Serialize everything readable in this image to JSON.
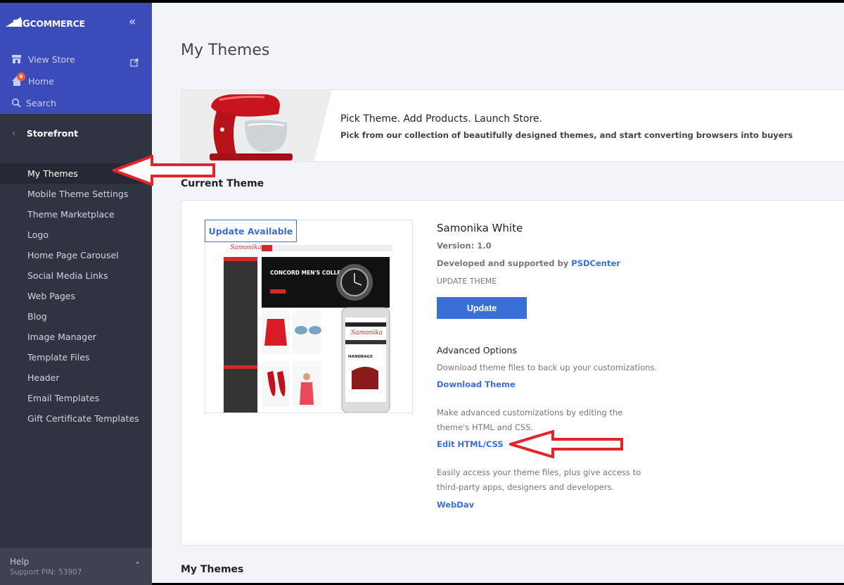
{
  "sidebar": {
    "logo": {
      "prefix": "BIG",
      "suffix": "COMMERCE"
    },
    "top_items": [
      {
        "label": "View Store",
        "icon": "store-icon"
      },
      {
        "label": "Home",
        "icon": "home-icon",
        "badge": "6"
      },
      {
        "label": "Search",
        "icon": "search-icon"
      }
    ],
    "section": "Storefront",
    "items": [
      {
        "label": "My Themes",
        "active": true
      },
      {
        "label": "Mobile Theme Settings"
      },
      {
        "label": "Theme Marketplace"
      },
      {
        "label": "Logo"
      },
      {
        "label": "Home Page Carousel"
      },
      {
        "label": "Social Media Links"
      },
      {
        "label": "Web Pages"
      },
      {
        "label": "Blog"
      },
      {
        "label": "Image Manager"
      },
      {
        "label": "Template Files"
      },
      {
        "label": "Header"
      },
      {
        "label": "Email Templates"
      },
      {
        "label": "Gift Certificate Templates"
      }
    ],
    "help": {
      "title": "Help",
      "pin": "Support PIN: 53907"
    }
  },
  "main": {
    "title": "My Themes",
    "banner": {
      "heading": "Pick Theme. Add Products. Launch Store.",
      "subheading": "Pick from our collection of beautifully designed themes, and start converting browsers into buyers"
    },
    "current_theme_heading": "Current Theme",
    "theme": {
      "update_available": "Update Available",
      "name": "Samonika White",
      "version": "Version: 1.0",
      "developer_prefix": "Developed and supported by ",
      "developer": "PSDCenter",
      "update_label": "UPDATE THEME",
      "update_button": "Update",
      "advanced_title": "Advanced Options",
      "download_desc": "Download theme files to back up your customizations.",
      "download_link": "Download Theme",
      "edit_desc": "Make advanced customizations by editing the theme's HTML and CSS.",
      "edit_link": "Edit HTML/CSS",
      "webdav_desc": "Easily access your theme files, plus give access to third-party apps, designers and developers.",
      "webdav_link": "WebDav"
    },
    "preview": {
      "brand": "Samonika",
      "hero_text": "CONCORD MEN'S COLLECTION",
      "mobile_brand": "Samonika",
      "mobile_label": "HANDBAGS"
    },
    "bottom_heading": "My Themes"
  },
  "colors": {
    "sidebar_top": "#3b4bb7",
    "sidebar": "#313440",
    "accent": "#3b6fd8",
    "arrow": "#e3242b"
  }
}
